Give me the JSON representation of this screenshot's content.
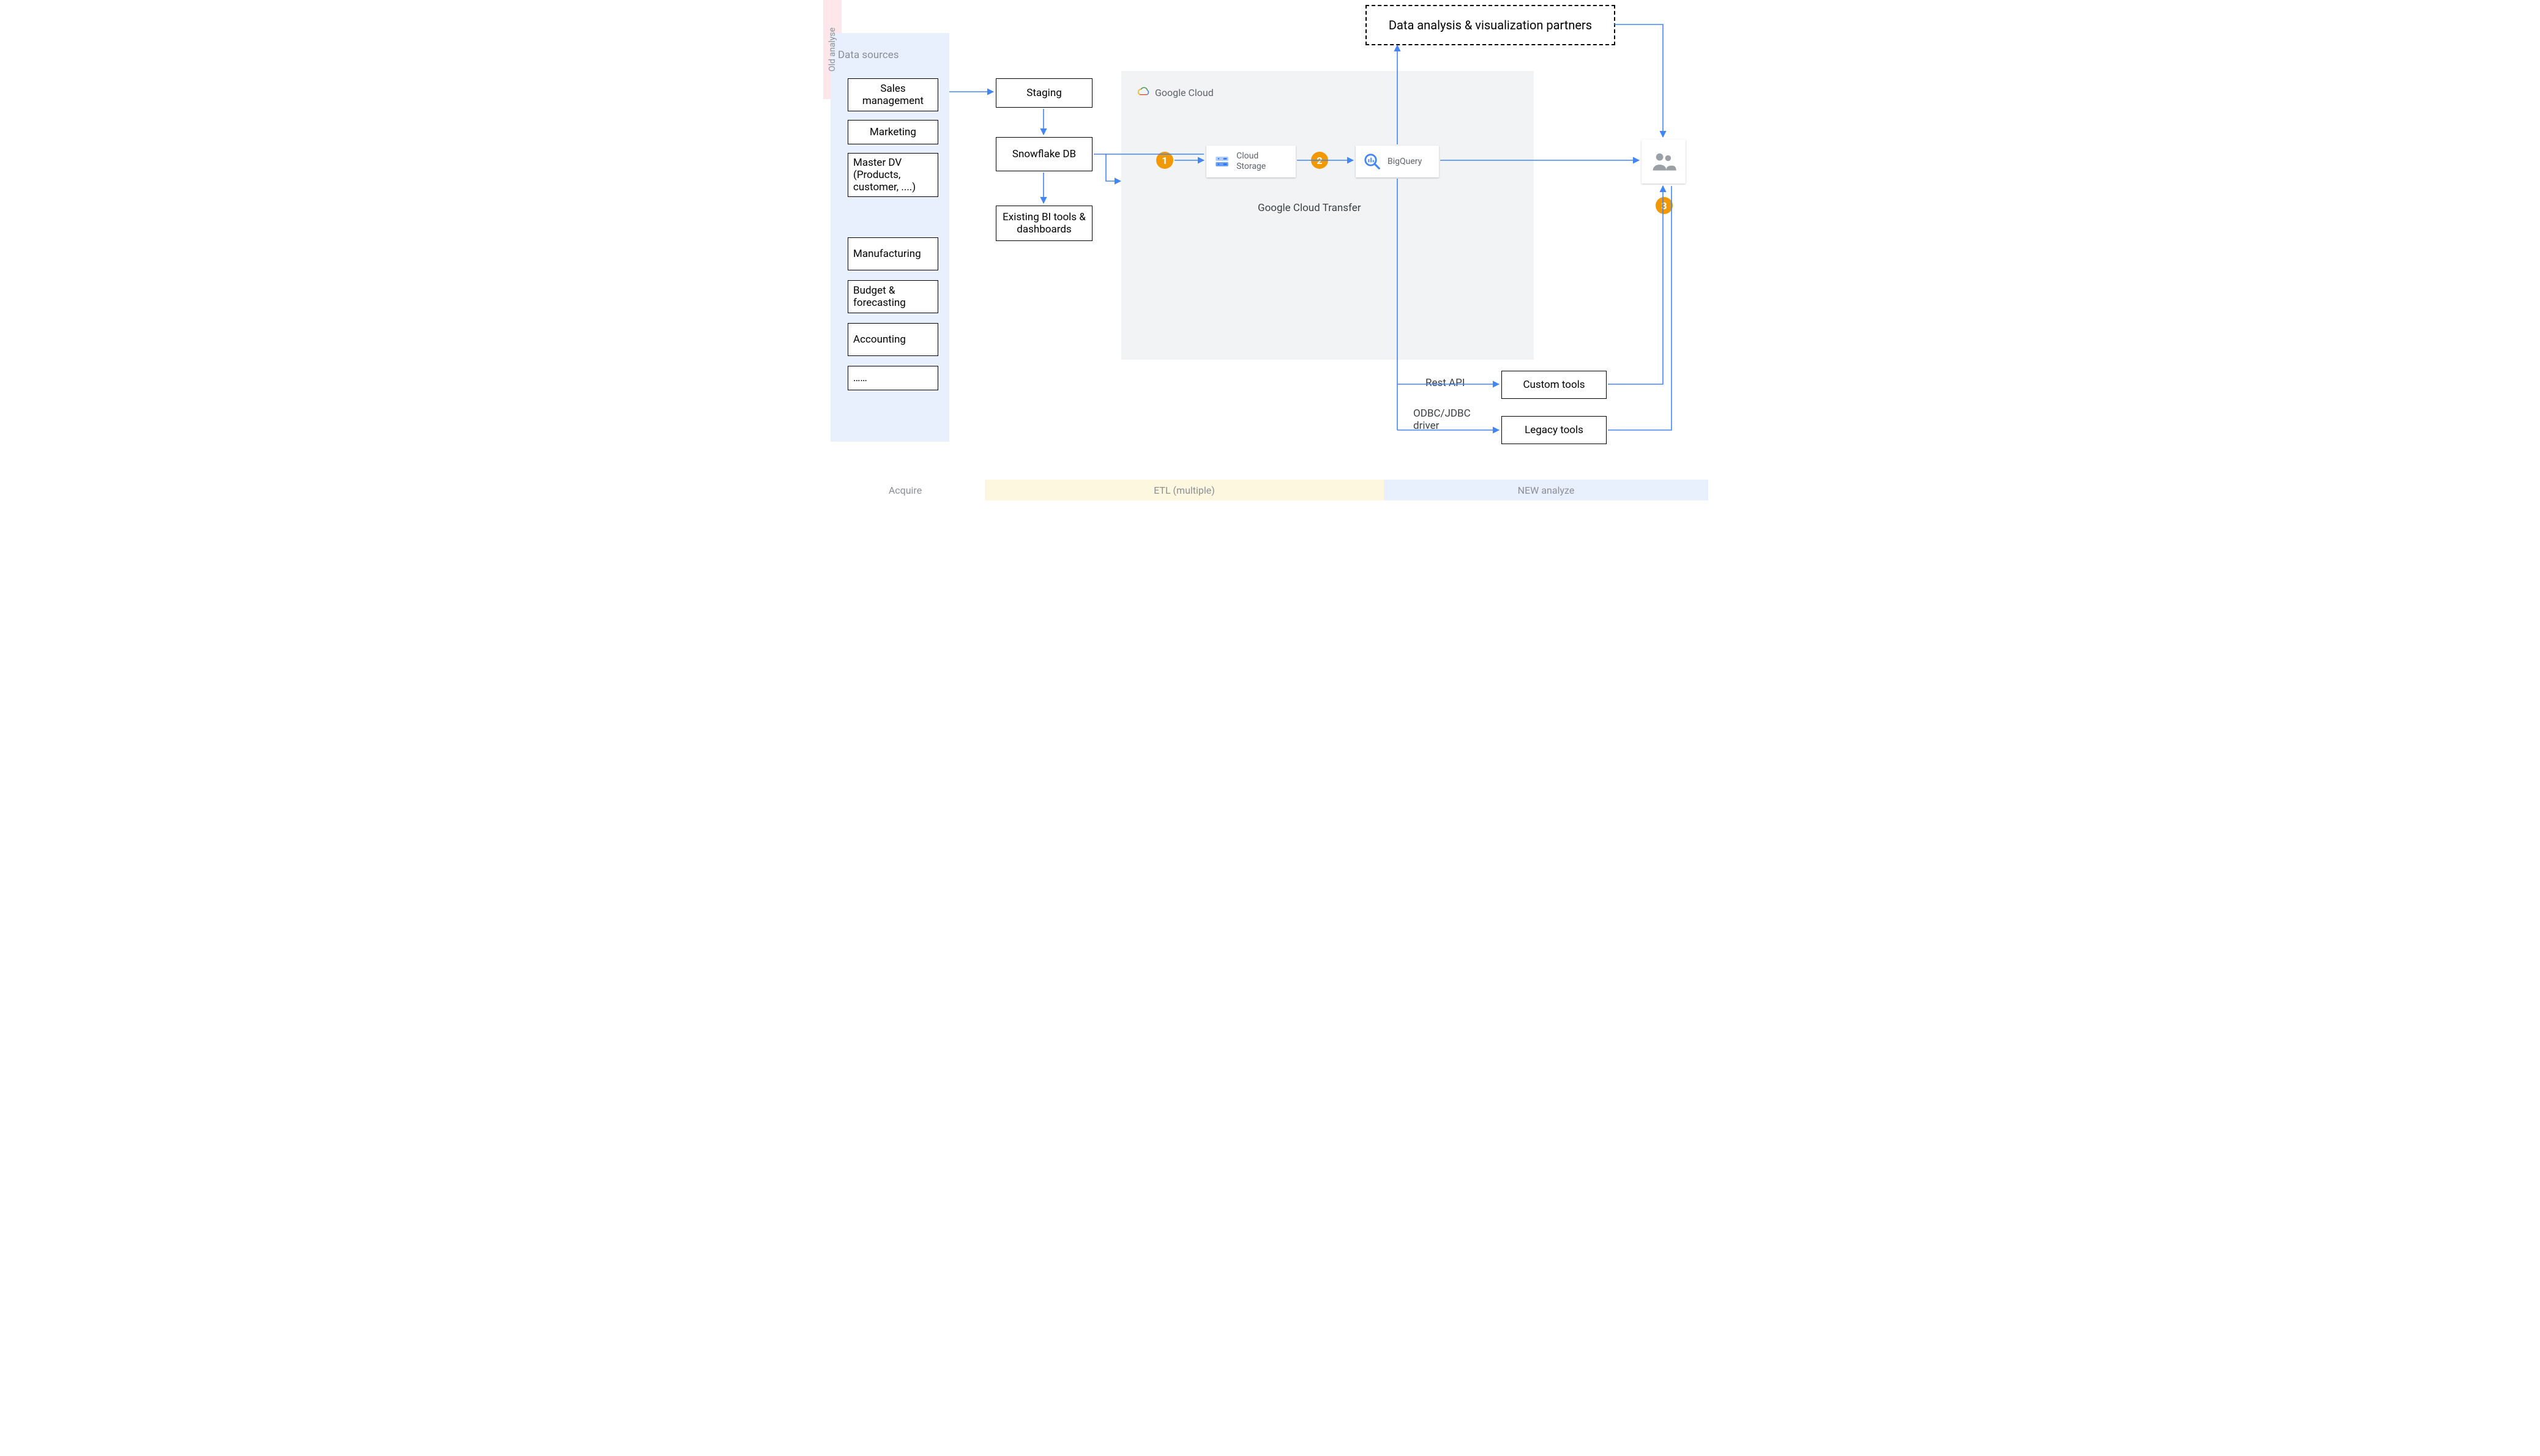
{
  "dataSources": {
    "title": "Data sources",
    "items": [
      "Sales management",
      "Marketing",
      "Master DV (Products, customer, ....)",
      "Manufacturing",
      "Budget & forecasting",
      "Accounting",
      "……"
    ]
  },
  "oldAnalyse": {
    "label": "Old analyse"
  },
  "etlBoxes": {
    "staging": "Staging",
    "snowflake": "Snowflake DB",
    "biTools": "Existing BI tools & dashboards"
  },
  "googleCloud": {
    "brand": "Google Cloud",
    "storage": "Cloud Storage",
    "bigquery": "BigQuery",
    "transferLabel": "Google Cloud Transfer"
  },
  "partnersBox": "Data analysis & visualization partners",
  "toolsRight": {
    "restApi": "Rest API",
    "odbc": "ODBC/JDBC driver",
    "custom": "Custom tools",
    "legacy": "Legacy tools"
  },
  "steps": {
    "one": "1",
    "two": "2",
    "three": "3"
  },
  "phases": {
    "acquire": "Acquire",
    "etl": "ETL (multiple)",
    "analyze": "NEW analyze"
  }
}
